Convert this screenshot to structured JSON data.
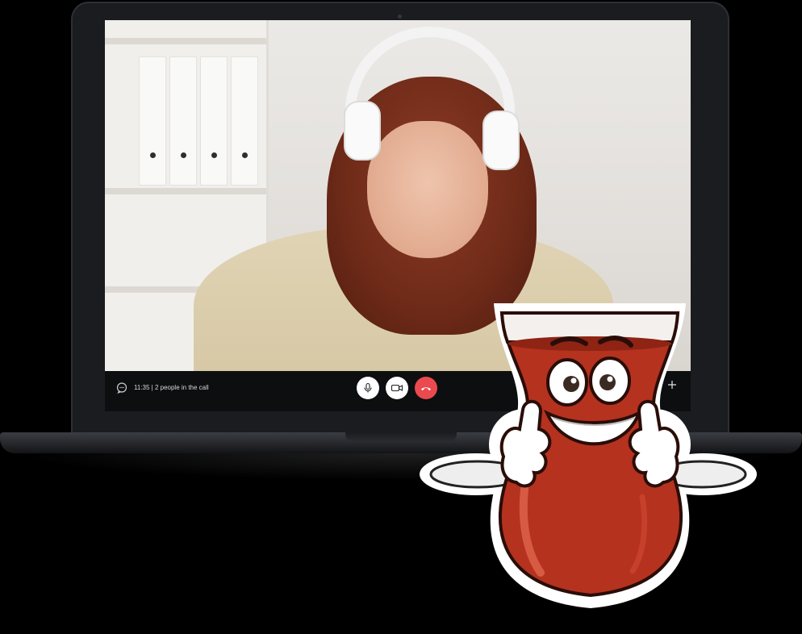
{
  "video_call": {
    "call_info": "11:35 | 2 people in the call",
    "controls": {
      "mic": "microphone-icon",
      "camera": "video-camera-icon",
      "end": "phone-hangup-icon",
      "chat": "chat-bubble-icon",
      "add": "plus-icon"
    },
    "colors": {
      "end_call": "#ea4a4f",
      "button_light": "#ffffff",
      "bar_background": "#0d0e10"
    }
  },
  "mascot": {
    "subject": "tea-glass-thumbs-up-mascot",
    "colors": {
      "tea": "#b5321f",
      "outline": "#2a0d08",
      "sticker_border": "#ffffff"
    }
  }
}
